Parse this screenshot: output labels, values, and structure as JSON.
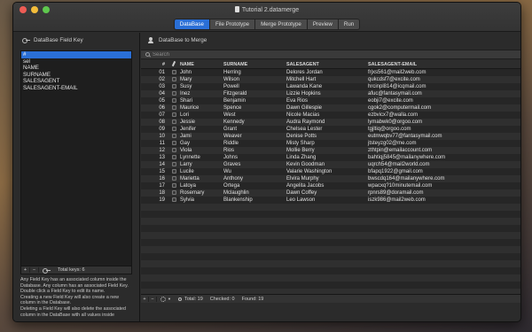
{
  "window": {
    "title": "Tutorial 2.datamerge"
  },
  "tabs": [
    {
      "label": "DataBase",
      "active": true
    },
    {
      "label": "File Prototype",
      "active": false
    },
    {
      "label": "Merge Prototype",
      "active": false
    },
    {
      "label": "Preview",
      "active": false
    },
    {
      "label": "Run",
      "active": false
    }
  ],
  "left_panel": {
    "header": "DataBase Field Key",
    "keys": [
      "#",
      "sel",
      "NAME",
      "SURNAME",
      "SALESAGENT",
      "SALESAGENT-EMAIL"
    ],
    "selected_key": "#",
    "footer": {
      "add": "+",
      "remove": "−",
      "total": "Total keys: 6"
    },
    "help": [
      "Any Field Key has an associated column inside the Database. Any column has an associated Field Key.",
      "Double click a Field Key to edit its name.",
      "Creating a new Field Key will also create a new column in the Database.",
      "Deleting a Field Key will also delete the associated column in the DataBase with all values inside"
    ]
  },
  "right_panel": {
    "header": "DataBase to Merge",
    "search_placeholder": "Search",
    "columns": [
      "#",
      "/",
      "NAME",
      "SURNAME",
      "SALESAGENT",
      "SALESAGENT-EMAIL"
    ],
    "rows": [
      [
        "01",
        "John",
        "Herring",
        "Delores Jordan",
        "frjxs561@mail2web.com"
      ],
      [
        "02",
        "Mary",
        "Wilson",
        "Mitchell Hart",
        "qukcdsf7@excite.com"
      ],
      [
        "03",
        "Susy",
        "Powell",
        "Lawanda Kane",
        "hrcinpl814@icqmail.com"
      ],
      [
        "04",
        "Inez",
        "Fitzgerald",
        "Lizzie Hopkins",
        "afuc@fantasymail.com"
      ],
      [
        "05",
        "Shari",
        "Benjamin",
        "Eva Rios",
        "eobji7@excite.com"
      ],
      [
        "06",
        "Maurice",
        "Spence",
        "Dawn Gillespie",
        "cgok2@computermail.com"
      ],
      [
        "07",
        "Lori",
        "West",
        "Nicole Macias",
        "ezbvicx7@walla.com"
      ],
      [
        "08",
        "Jessie",
        "Kennedy",
        "Audra Raymond",
        "lymabwk0@orgoo.com"
      ],
      [
        "09",
        "Jenifer",
        "Grant",
        "Chelsea Lester",
        "tgjltiq@orgoo.com"
      ],
      [
        "10",
        "Jami",
        "Weaver",
        "Denise Potts",
        "eutmwqbv77@fantasymail.com"
      ],
      [
        "11",
        "Gay",
        "Riddle",
        "Misty Sharp",
        "jtsteyzg02@me.com"
      ],
      [
        "12",
        "Viola",
        "Rios",
        "Mollie Berry",
        "zthtpin@emailaccount.com"
      ],
      [
        "13",
        "Lynnette",
        "Johns",
        "Linda Zhang",
        "bahtiqj5845@mailanywhere.com"
      ],
      [
        "14",
        "Larry",
        "Graves",
        "Kevin Goodman",
        "uqrch54@mail2world.com"
      ],
      [
        "15",
        "Lucile",
        "Wu",
        "Valarie Washington",
        "bfapq1922@gmail.com"
      ],
      [
        "16",
        "Marietta",
        "Anthony",
        "Elvira Murphy",
        "bwscdq164@mailanywhere.com"
      ],
      [
        "17",
        "Latoya",
        "Ortega",
        "Angelita Jacobs",
        "wpacxq?10minutemail.com"
      ],
      [
        "18",
        "Rosemary",
        "Mclaughlin",
        "Dawn Coffey",
        "rpnrs89@doramail.com"
      ],
      [
        "19",
        "Sylvia",
        "Blankenship",
        "Leo Lawson",
        "iszk986@mail2web.com"
      ]
    ],
    "empty_rows": 14,
    "footer": {
      "add": "+",
      "remove": "−",
      "total": "Total: 19",
      "checked": "Checked: 0",
      "found": "Found: 19"
    }
  }
}
